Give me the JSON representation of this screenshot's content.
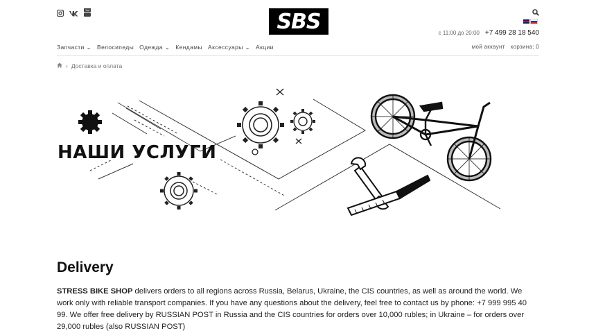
{
  "header": {
    "logo_text": "SBS",
    "social": [
      "instagram-icon",
      "vk-icon",
      "youtube-icon"
    ],
    "hours": "с 11:00 до 20:00",
    "phone": "+7 499 28 18 540"
  },
  "nav": {
    "items": [
      {
        "label": "Запчасти",
        "dropdown": true
      },
      {
        "label": "Велосипеды",
        "dropdown": false
      },
      {
        "label": "Одежда",
        "dropdown": true
      },
      {
        "label": "Кендамы",
        "dropdown": false
      },
      {
        "label": "Аксессуары",
        "dropdown": true
      },
      {
        "label": "Акции",
        "dropdown": false
      }
    ],
    "account": "мой аккаунт",
    "cart": "корзина: 0"
  },
  "breadcrumb": {
    "current": "Доставка и оплата"
  },
  "hero": {
    "title": "НАШИ УСЛУГИ"
  },
  "content": {
    "heading": "Delivery",
    "shop_name": "STRESS BIKE SHOP",
    "text": " delivers orders to all regions across Russia, Belarus, Ukraine, the CIS countries, as well as around the world. We work only with reliable transport companies. If you have any questions about the delivery, feel free to contact us by phone: +7 999 995 40 99. We offer free delivery by RUSSIAN POST in Russia and the CIS countries for orders over 10,000 rubles; in Ukraine – for orders over 29,000 rubles (also RUSSIAN POST)"
  },
  "colors": {
    "text": "#222222",
    "logo_bg": "#000000"
  }
}
